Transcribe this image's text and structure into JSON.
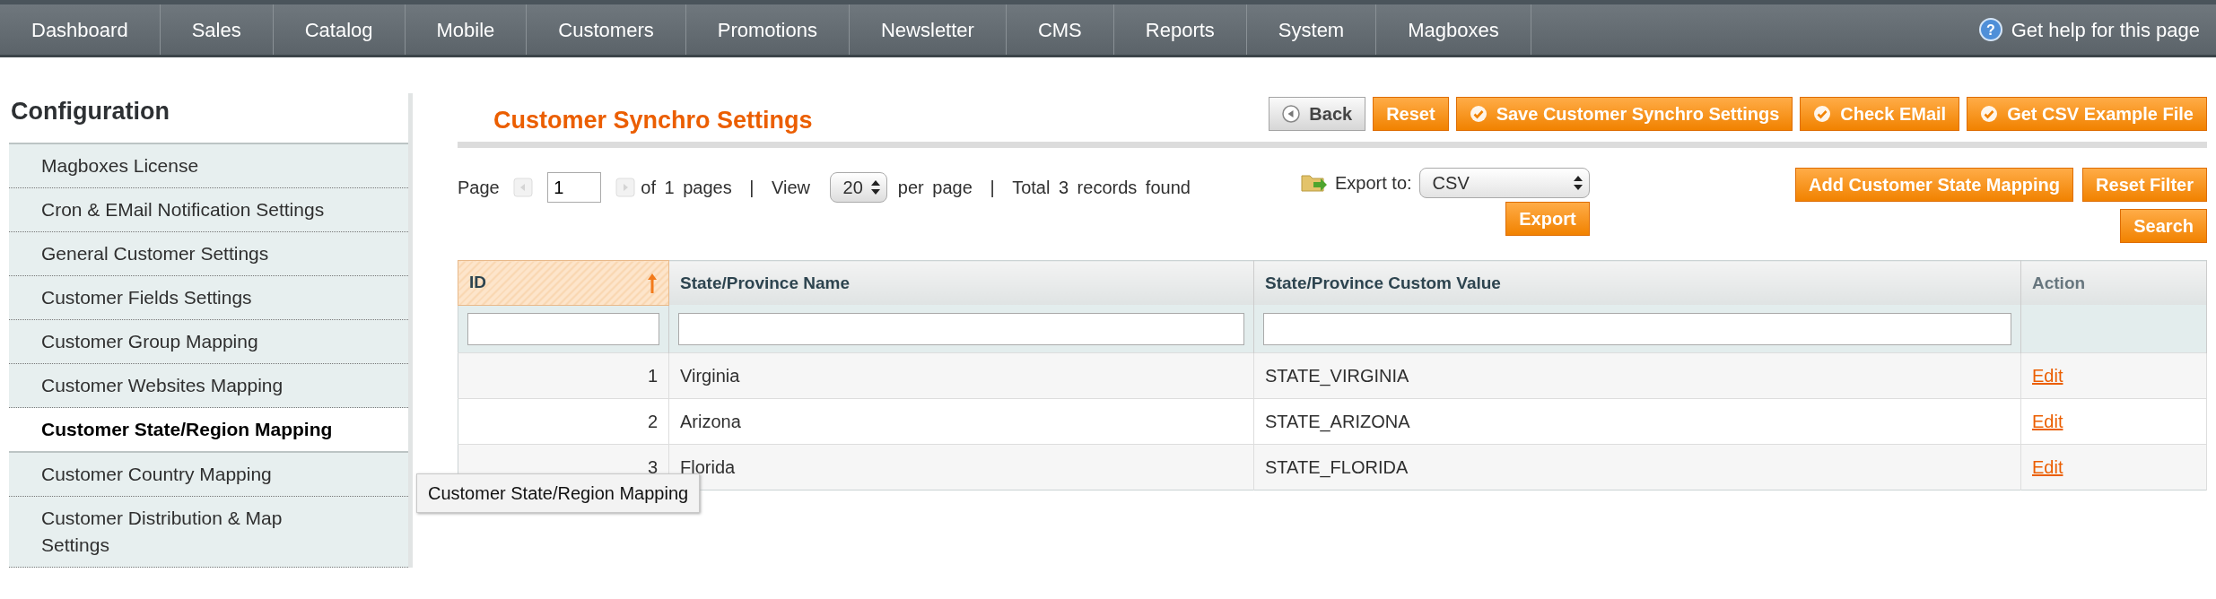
{
  "nav": {
    "items": [
      {
        "label": "Dashboard",
        "selected": false
      },
      {
        "label": "Sales",
        "selected": false
      },
      {
        "label": "Catalog",
        "selected": false
      },
      {
        "label": "Mobile",
        "selected": false
      },
      {
        "label": "Customers",
        "selected": false
      },
      {
        "label": "Promotions",
        "selected": false
      },
      {
        "label": "Newsletter",
        "selected": false
      },
      {
        "label": "CMS",
        "selected": false
      },
      {
        "label": "Reports",
        "selected": false
      },
      {
        "label": "System",
        "selected": false
      },
      {
        "label": "Magboxes",
        "selected": false
      }
    ],
    "help": "Get help for this page",
    "help_icon": "?"
  },
  "sidebar": {
    "title": "Configuration",
    "items": [
      {
        "label": "Magboxes License",
        "selected": false
      },
      {
        "label": "Cron & EMail Notification Settings",
        "selected": false
      },
      {
        "label": "General Customer Settings",
        "selected": false
      },
      {
        "label": "Customer Fields Settings",
        "selected": false
      },
      {
        "label": "Customer Group Mapping",
        "selected": false
      },
      {
        "label": "Customer Websites Mapping",
        "selected": false
      },
      {
        "label": "Customer State/Region Mapping",
        "selected": true
      },
      {
        "label": "Customer Country Mapping",
        "selected": false
      },
      {
        "label": "Customer Distribution & Map Settings",
        "selected": false
      }
    ]
  },
  "page": {
    "title": "Customer Synchro Settings",
    "buttons": [
      {
        "label": "Back",
        "kind": "back"
      },
      {
        "label": "Reset",
        "kind": "plain"
      },
      {
        "label": "Save Customer Synchro Settings",
        "kind": "check"
      },
      {
        "label": "Check EMail",
        "kind": "check"
      },
      {
        "label": "Get CSV Example File",
        "kind": "check"
      }
    ]
  },
  "pager": {
    "page_label": "Page",
    "page_value": "1",
    "of_pages": "of 1 pages",
    "separator_1": "|",
    "view_label": "View",
    "per_page": "20",
    "per_page_label": "per page",
    "separator_2": "|",
    "total": "Total 3 records found"
  },
  "export": {
    "label": "Export to:",
    "format": "CSV",
    "button": "Export"
  },
  "grid_buttons": [
    "Add Customer State Mapping",
    "Reset Filter",
    "Search"
  ],
  "table": {
    "columns": [
      {
        "label": "ID",
        "sorted": true
      },
      {
        "label": "State/Province Name",
        "sorted": false
      },
      {
        "label": "State/Province Custom Value",
        "sorted": false
      },
      {
        "label": "Action",
        "sorted": false
      }
    ],
    "rows": [
      {
        "id": "1",
        "name": "Virginia",
        "value": "STATE_VIRGINIA",
        "action": "Edit"
      },
      {
        "id": "2",
        "name": "Arizona",
        "value": "STATE_ARIZONA",
        "action": "Edit"
      },
      {
        "id": "3",
        "name": "Florida",
        "value": "STATE_FLORIDA",
        "action": "Edit"
      }
    ]
  },
  "tooltip": "Customer State/Region Mapping"
}
